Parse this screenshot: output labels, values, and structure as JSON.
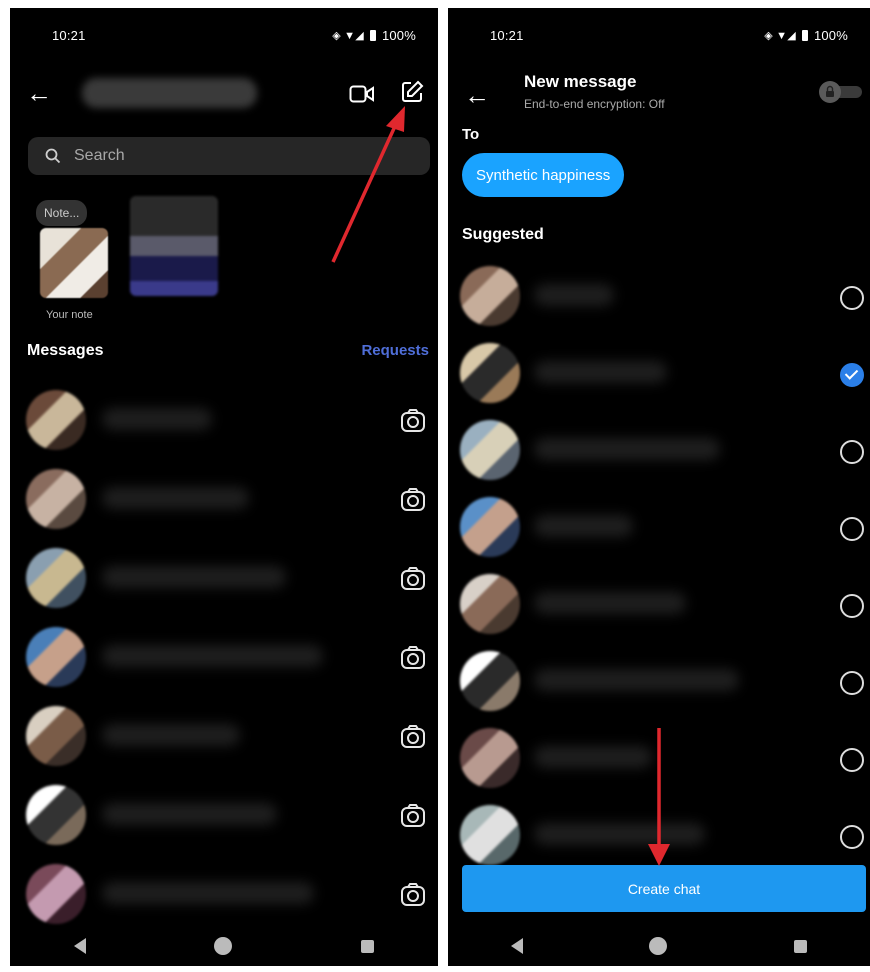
{
  "left_screen": {
    "status": {
      "time": "10:21",
      "battery": "100%"
    },
    "search": {
      "placeholder": "Search"
    },
    "note": {
      "bubble": "Note...",
      "caption": "Your note"
    },
    "messages_header": "Messages",
    "requests_label": "Requests",
    "conversations": [
      {
        "avatar_colors": [
          "#6b4a3a",
          "#c9b79a",
          "#3a2a22"
        ]
      },
      {
        "avatar_colors": [
          "#8a6c5e",
          "#c7b2a3",
          "#5a4a40"
        ]
      },
      {
        "avatar_colors": [
          "#8a9fb0",
          "#c8b890",
          "#405060"
        ]
      },
      {
        "avatar_colors": [
          "#4a7fb8",
          "#c6a08a",
          "#2a3a58"
        ]
      },
      {
        "avatar_colors": [
          "#d9cfc1",
          "#7a5c48",
          "#3a2e28"
        ]
      },
      {
        "avatar_colors": [
          "#ffffff",
          "#333333",
          "#7a6a5a"
        ]
      },
      {
        "avatar_colors": [
          "#7a4a5a",
          "#c49ab0",
          "#3a1e2a"
        ]
      }
    ]
  },
  "right_screen": {
    "status": {
      "time": "10:21",
      "battery": "100%"
    },
    "title": "New message",
    "subtitle": "End-to-end encryption: Off",
    "to_label": "To",
    "chip": "Synthetic happiness",
    "suggested_label": "Suggested",
    "suggestions": [
      {
        "checked": false,
        "avatar_colors": [
          "#8a6a58",
          "#c6ad9a",
          "#4a3a30"
        ]
      },
      {
        "checked": true,
        "avatar_colors": [
          "#d8c8a8",
          "#2a2a2a",
          "#9a7a58"
        ]
      },
      {
        "checked": false,
        "avatar_colors": [
          "#9ab0c0",
          "#d8d0b8",
          "#5a6470"
        ]
      },
      {
        "checked": false,
        "avatar_colors": [
          "#5a90c8",
          "#c4a08c",
          "#2a3a58"
        ]
      },
      {
        "checked": false,
        "avatar_colors": [
          "#d8d0c8",
          "#8a6a58",
          "#4a3a30"
        ]
      },
      {
        "checked": false,
        "avatar_colors": [
          "#ffffff",
          "#2a2a2a",
          "#8a7a6a"
        ]
      },
      {
        "checked": false,
        "avatar_colors": [
          "#6a4a48",
          "#b89a90",
          "#3a2a2a"
        ]
      },
      {
        "checked": false,
        "avatar_colors": [
          "#a8b8b8",
          "#e0e0e0",
          "#58686a"
        ]
      }
    ],
    "create_chat_label": "Create chat"
  },
  "colors": {
    "accent": "#1e98f0",
    "chip": "#1aa3ff",
    "requests": "#4f6ed8",
    "check": "#2b7fe8",
    "annotation_arrow": "#e0282e"
  }
}
